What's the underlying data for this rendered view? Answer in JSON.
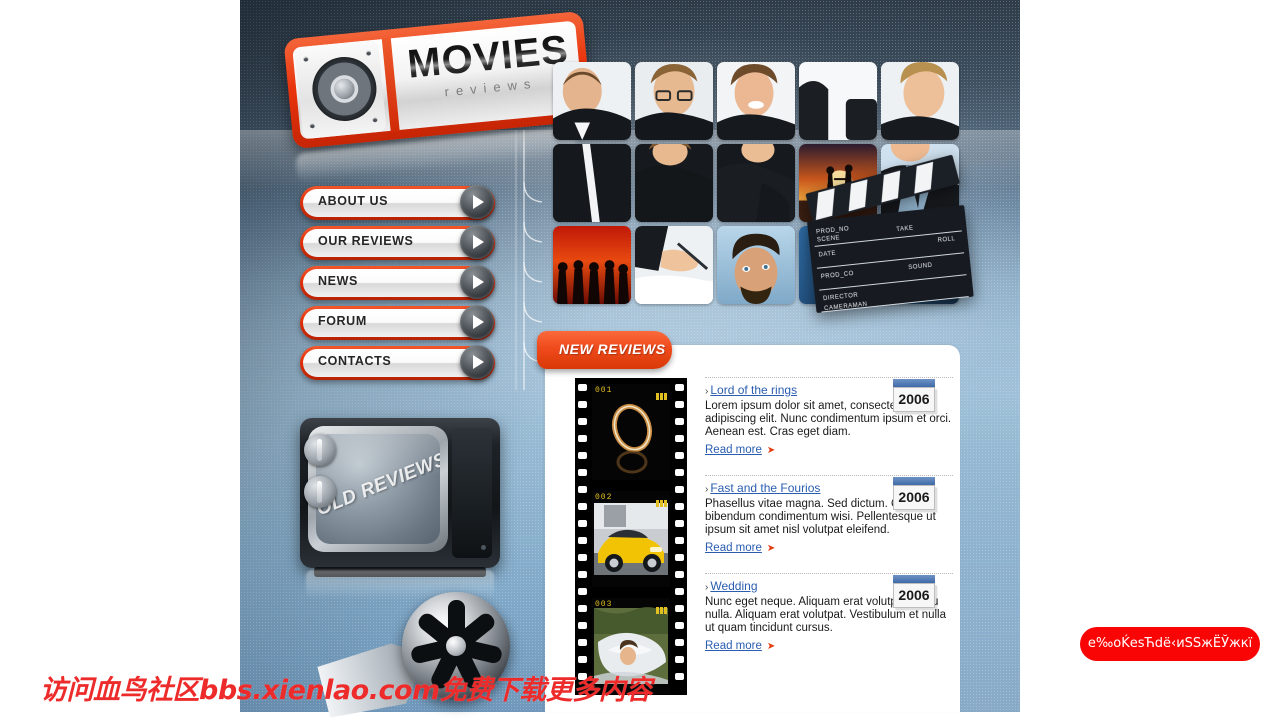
{
  "logo": {
    "title": "MOVIES",
    "subtitle": "reviews",
    "icon": "speaker-icon"
  },
  "nav": {
    "items": [
      {
        "label": "ABOUT US",
        "icon": "play-circle-icon"
      },
      {
        "label": "OUR REVIEWS",
        "icon": "play-circle-icon"
      },
      {
        "label": "NEWS",
        "icon": "play-circle-icon"
      },
      {
        "label": "FORUM",
        "icon": "play-circle-icon"
      },
      {
        "label": "CONTACTS",
        "icon": "play-circle-icon"
      }
    ]
  },
  "old_reviews": {
    "label": "OLD REVIEWS",
    "icon": "retro-tv-icon"
  },
  "new_reviews": {
    "tab_label": "NEW REVIEWS",
    "items": [
      {
        "frame_no": "001",
        "title": "Lord of the rings",
        "text": "Lorem ipsum dolor sit amet, consectetuer adipiscing elit. Nunc condimentum ipsum et orci. Aenean est. Cras eget diam.",
        "read_more": "Read more",
        "year": "2006"
      },
      {
        "frame_no": "002",
        "title": "Fast and the Fourios",
        "text": "Phasellus vitae magna. Sed dictum. Quisque bibendum condimentum wisi. Pellentesque ut ipsum sit amet nisl volutpat eleifend.",
        "read_more": "Read more",
        "year": "2006"
      },
      {
        "frame_no": "003",
        "title": "Wedding",
        "text": "Nunc eget neque. Aliquam erat volutpat. In eu nulla. Aliquam erat volutpat. Vestibulum et nulla ut quam tincidunt cursus.",
        "read_more": "Read more",
        "year": "2006"
      }
    ]
  },
  "clapper": {
    "icon": "clapperboard-icon",
    "fields": [
      "PROD_NO",
      "SCENE",
      "TAKE",
      "ROLL",
      "DATE",
      "PROD_CO",
      "DIRECTOR",
      "SOUND",
      "CAMERAMAN"
    ]
  },
  "film_reel": {
    "icon": "film-reel-icon"
  },
  "watermark": {
    "text": "访问血鸟社区bbs.xienlao.com免费下载更多内容"
  },
  "cta": {
    "label": "e‰oḰesЋdë‹иSSжЁЎжкï"
  },
  "colors": {
    "accent_red": "#e8340c",
    "tab_orange": "#ef4a1c",
    "link_blue": "#2a5db0",
    "year_bar_blue": "#3f6ba8",
    "cta_red": "#f90505",
    "watermark_red": "#ee2b2b",
    "bg_blue": "#9fc0d8"
  }
}
